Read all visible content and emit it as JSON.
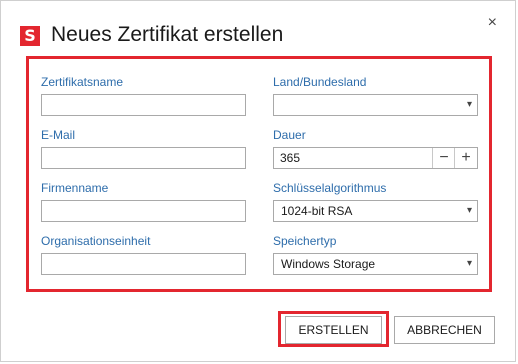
{
  "dialog": {
    "title": "Neues Zertifikat erstellen",
    "logo_letter": "S",
    "close_glyph": "×"
  },
  "form": {
    "left": [
      {
        "label": "Zertifikatsname",
        "value": ""
      },
      {
        "label": "E-Mail",
        "value": ""
      },
      {
        "label": "Firmenname",
        "value": ""
      },
      {
        "label": "Organisationseinheit",
        "value": ""
      }
    ],
    "country": {
      "label": "Land/Bundesland",
      "value": ""
    },
    "duration": {
      "label": "Dauer",
      "value": "365",
      "minus": "−",
      "plus": "+"
    },
    "key_algorithm": {
      "label": "Schlüsselalgorithmus",
      "value": "1024-bit RSA"
    },
    "storage_type": {
      "label": "Speichertyp",
      "value": "Windows Storage"
    }
  },
  "buttons": {
    "create": "ERSTELLEN",
    "cancel": "ABBRECHEN"
  },
  "colors": {
    "accent_red": "#e3262f",
    "label_blue": "#2e6dab"
  },
  "icons": {
    "logo": "s-logo-icon",
    "close": "close-icon",
    "dropdown": "chevron-down-icon"
  }
}
